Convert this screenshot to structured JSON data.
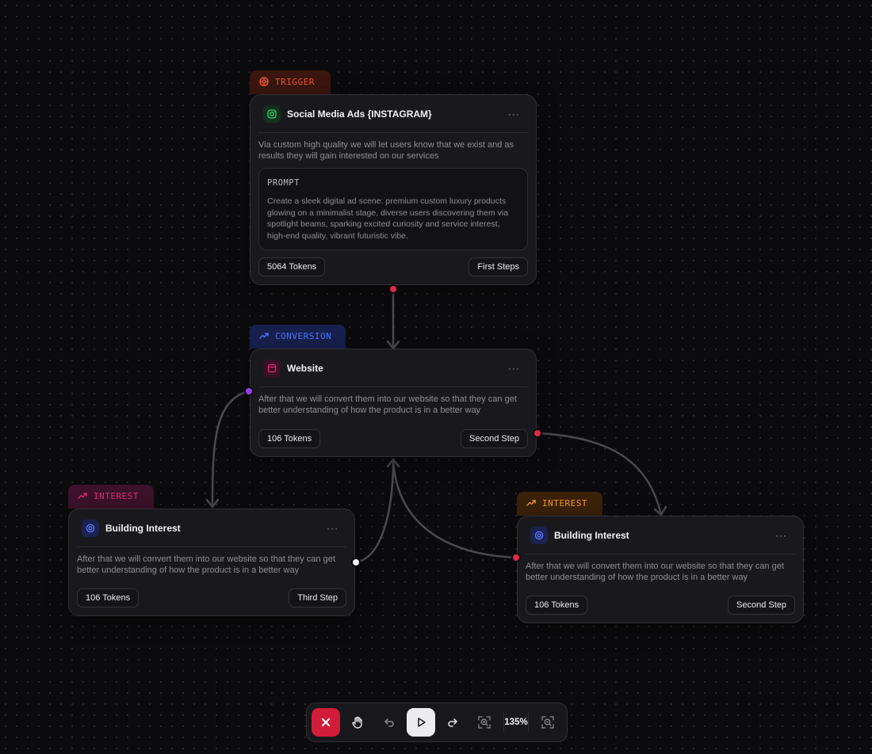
{
  "nodes": {
    "trigger": {
      "tag": "TRIGGER",
      "title": "Social Media Ads {INSTAGRAM}",
      "description": "Via custom high quality we will let users know that we exist and as results they will gain interested on our services",
      "prompt_label": "PROMPT",
      "prompt": "Create a sleek digital ad scene: premium custom luxury products glowing on a minimalist stage, diverse users discovering them via spotlight beams, sparking excited curiosity and service interest, high-end quality, vibrant futuristic vibe.",
      "tokens": "5064 Tokens",
      "step": "First Steps",
      "icon": "instagram-icon"
    },
    "conversion": {
      "tag": "CONVERSION",
      "title": "Website",
      "description": "After that we will convert them into our website so that they can get better understanding of how the product is in a better way",
      "tokens": "106 Tokens",
      "step": "Second Step",
      "icon": "browser-icon"
    },
    "interest_left": {
      "tag": "INTEREST",
      "title": "Building Interest",
      "description": "After that we will convert them into our website so that they can get better understanding of how the product is in a better way",
      "tokens": "106 Tokens",
      "step": "Third Step",
      "icon": "target-icon"
    },
    "interest_right": {
      "tag": "INTEREST",
      "title": "Building Interest",
      "description": "After that we will convert them into our website so that they can get better understanding of how the product is in a better way",
      "tokens": "106 Tokens",
      "step": "Second Step",
      "icon": "target-icon"
    }
  },
  "menu_label": "···",
  "toolbar": {
    "zoom": "135%",
    "buttons": [
      "close-icon",
      "hand-icon",
      "undo-icon",
      "play-icon",
      "redo-icon",
      "zoom-in-icon",
      "zoom-out-icon"
    ]
  },
  "colors": {
    "trigger_tag_bg": "#3a160f",
    "trigger_tag_fg": "#f0542e",
    "conversion_tag_bg": "#17204d",
    "conversion_tag_fg": "#4e73ff",
    "interest_pink_bg": "#3b1229",
    "interest_pink_fg": "#e0297a",
    "interest_orange_bg": "#3b2109",
    "interest_orange_fg": "#f29a1f",
    "close_button": "#d11c3a",
    "edge": "#4a4a50"
  }
}
